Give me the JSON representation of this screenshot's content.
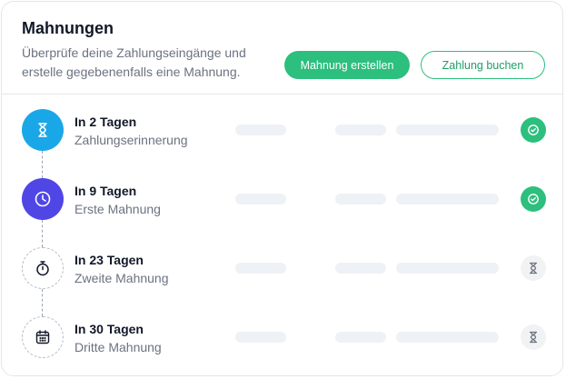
{
  "header": {
    "title": "Mahnungen",
    "subtitle": "Überprüfe deine Zahlungseingänge und erstelle gegebenenfalls eine Mahnung.",
    "primary_button": "Mahnung erstellen",
    "secondary_button": "Zahlung buchen"
  },
  "colors": {
    "accent": "#2cbf7e",
    "step1": "#1aa7e8",
    "step2": "#4f46e5"
  },
  "steps": [
    {
      "when": "In 2 Tagen",
      "label": "Zahlungserinnerung",
      "icon": "hourglass-icon",
      "status": "completed"
    },
    {
      "when": "In 9 Tagen",
      "label": "Erste Mahnung",
      "icon": "clock-icon",
      "status": "completed"
    },
    {
      "when": "In 23 Tagen",
      "label": "Zweite Mahnung",
      "icon": "stopwatch-icon",
      "status": "pending"
    },
    {
      "when": "In 30 Tagen",
      "label": "Dritte Mahnung",
      "icon": "calendar-icon",
      "status": "pending"
    }
  ]
}
